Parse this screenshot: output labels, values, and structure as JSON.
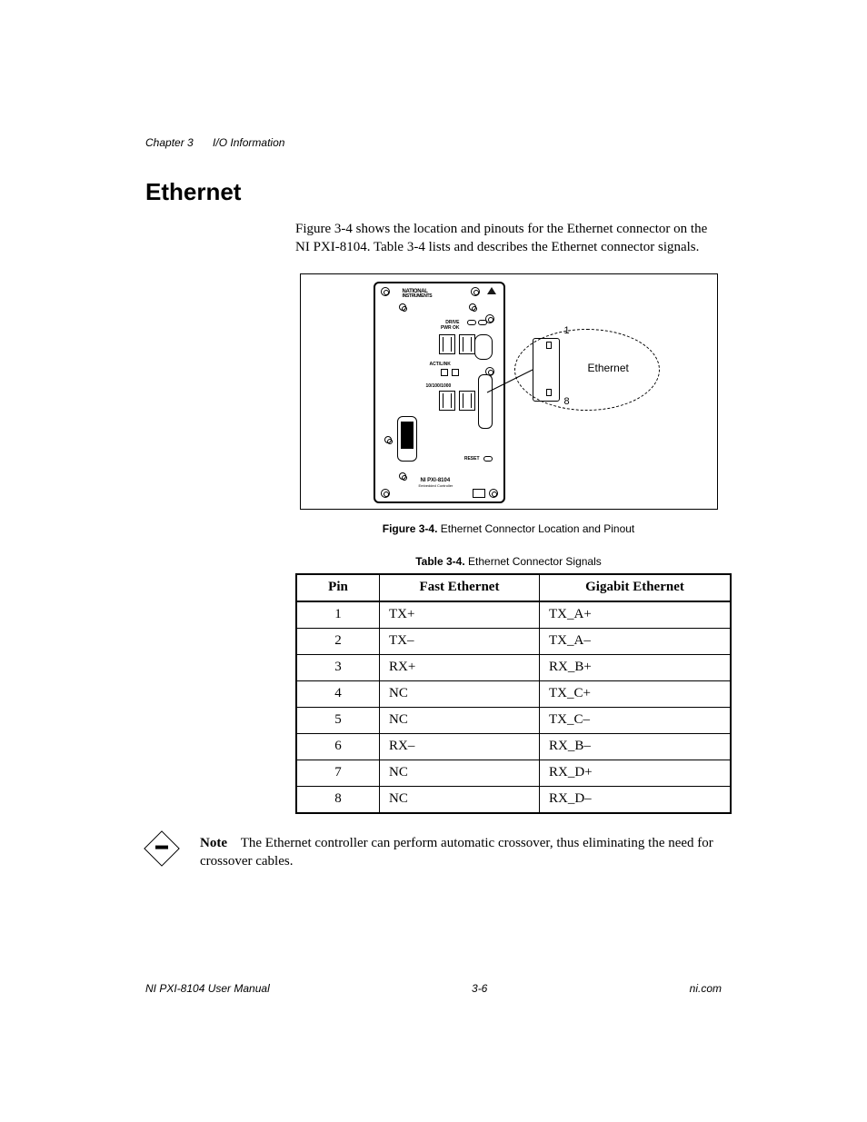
{
  "header": {
    "chapter": "Chapter 3",
    "title": "I/O Information"
  },
  "section_heading": "Ethernet",
  "intro": "Figure 3-4 shows the location and pinouts for the Ethernet connector on the NI PXI-8104. Table 3-4 lists and describes the Ethernet connector signals.",
  "figure": {
    "caption_lead": "Figure 3-4.",
    "caption_rest": "Ethernet Connector Location and Pinout",
    "callout_label": "Ethernet",
    "callout_pin_top": "1",
    "callout_pin_bottom": "8",
    "brand_top": "NATIONAL",
    "brand_bottom": "INSTRUMENTS",
    "model_line1": "NI PXI-8104",
    "model_line2": "Embedded Controller"
  },
  "table": {
    "caption_lead": "Table 3-4.",
    "caption_rest": "Ethernet Connector Signals",
    "columns": [
      "Pin",
      "Fast Ethernet",
      "Gigabit Ethernet"
    ],
    "rows": [
      {
        "pin": "1",
        "fast": "TX+",
        "gig": "TX_A+"
      },
      {
        "pin": "2",
        "fast": "TX–",
        "gig": "TX_A–"
      },
      {
        "pin": "3",
        "fast": "RX+",
        "gig": "RX_B+"
      },
      {
        "pin": "4",
        "fast": "NC",
        "gig": "TX_C+"
      },
      {
        "pin": "5",
        "fast": "NC",
        "gig": "TX_C–"
      },
      {
        "pin": "6",
        "fast": "RX–",
        "gig": "RX_B–"
      },
      {
        "pin": "7",
        "fast": "NC",
        "gig": "RX_D+"
      },
      {
        "pin": "8",
        "fast": "NC",
        "gig": "RX_D–"
      }
    ]
  },
  "note": {
    "lead": "Note",
    "text": "The Ethernet controller can perform automatic crossover, thus eliminating the need for crossover cables."
  },
  "footer": {
    "left": "NI PXI-8104 User Manual",
    "center": "3-6",
    "right": "ni.com"
  }
}
